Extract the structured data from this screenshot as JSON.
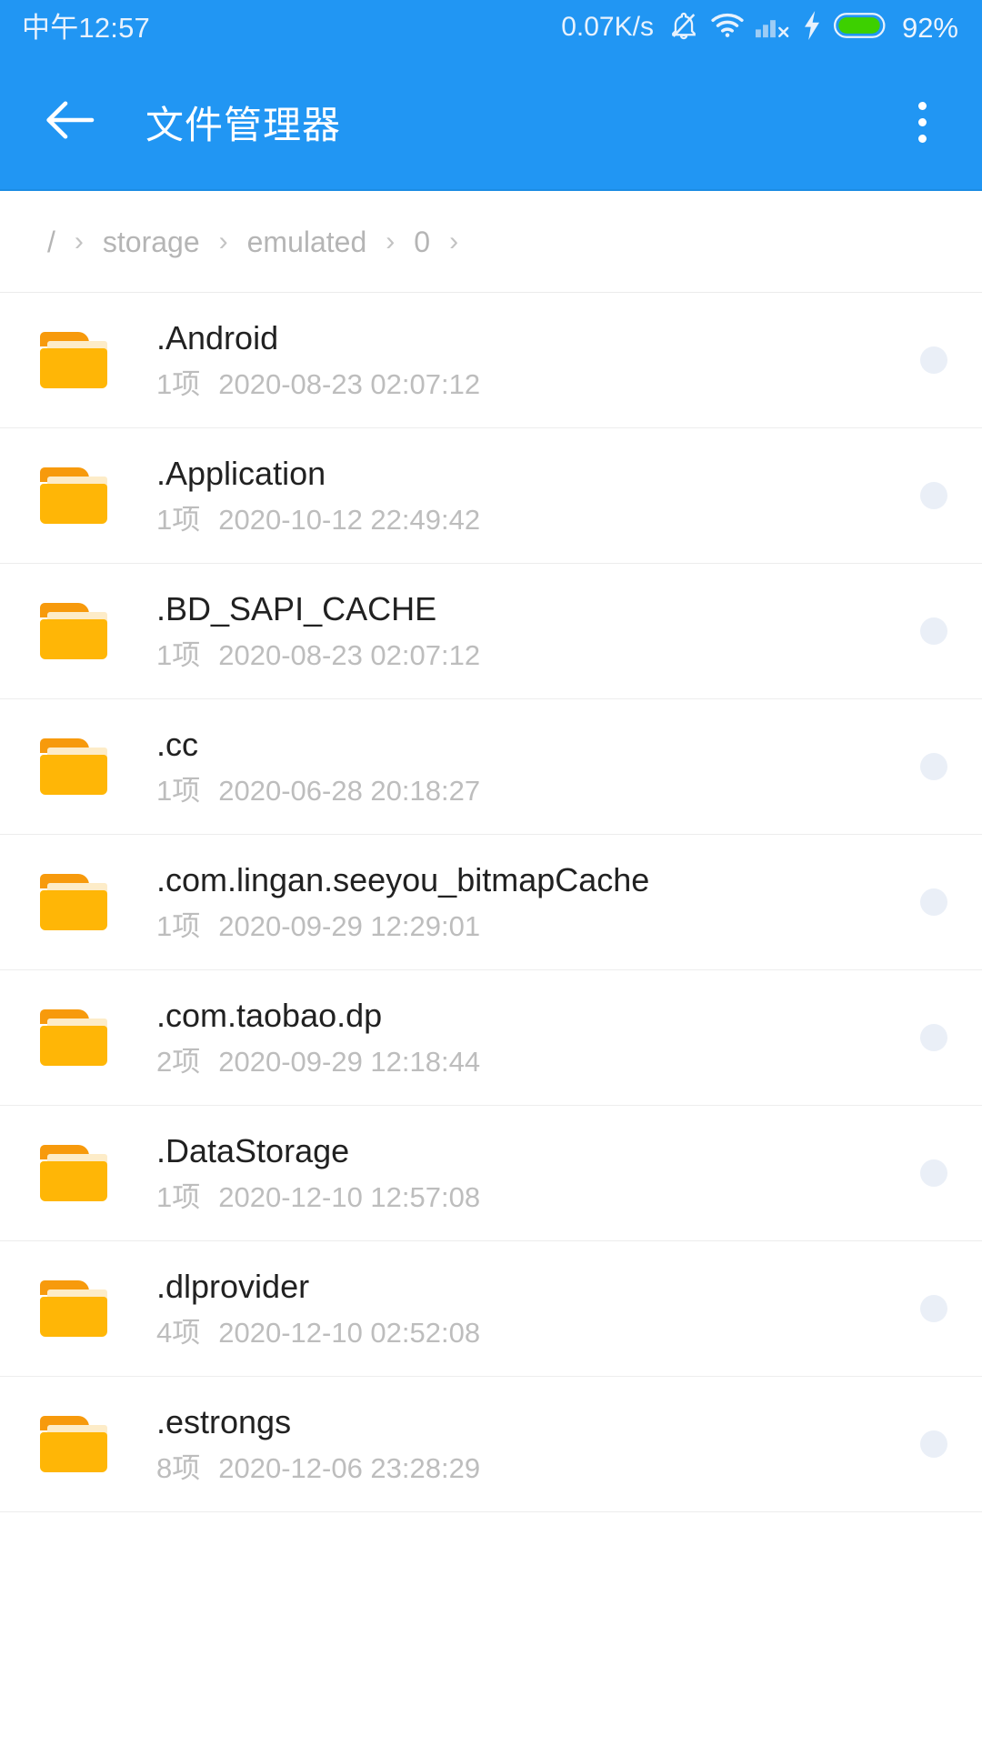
{
  "theme": {
    "accent": "#2196f3",
    "folder_body": "#ffb606",
    "folder_tab": "#f79a0c",
    "folder_sheet": "#fdecc8",
    "indicator": "#eaeff7",
    "title_text": "#ffffff",
    "name_text": "#212121",
    "sub_text": "#bdbdbd",
    "crumb_text": "#b5b5b5"
  },
  "status_bar": {
    "time": "中午12:57",
    "net_speed": "0.07K/s",
    "battery_percent": "92%",
    "icons": [
      "mute-bell-icon",
      "wifi-icon",
      "signal-no-service-icon",
      "charging-bolt-icon",
      "battery-icon"
    ]
  },
  "app_bar": {
    "back_icon": "back-arrow-icon",
    "title": "文件管理器",
    "overflow_icon": "overflow-menu-icon"
  },
  "breadcrumb": {
    "separator": "›",
    "segments": [
      "/",
      "storage",
      "emulated",
      "0"
    ],
    "trailing_separator": "›"
  },
  "file_list": {
    "items": [
      {
        "name": ".Android",
        "count": "1项",
        "modified": "2020-08-23 02:07:12",
        "icon": "folder-icon"
      },
      {
        "name": ".Application",
        "count": "1项",
        "modified": "2020-10-12 22:49:42",
        "icon": "folder-icon"
      },
      {
        "name": ".BD_SAPI_CACHE",
        "count": "1项",
        "modified": "2020-08-23 02:07:12",
        "icon": "folder-icon"
      },
      {
        "name": ".cc",
        "count": "1项",
        "modified": "2020-06-28 20:18:27",
        "icon": "folder-icon"
      },
      {
        "name": ".com.lingan.seeyou_bitmapCache",
        "count": "1项",
        "modified": "2020-09-29 12:29:01",
        "icon": "folder-icon"
      },
      {
        "name": ".com.taobao.dp",
        "count": "2项",
        "modified": "2020-09-29 12:18:44",
        "icon": "folder-icon"
      },
      {
        "name": ".DataStorage",
        "count": "1项",
        "modified": "2020-12-10 12:57:08",
        "icon": "folder-icon"
      },
      {
        "name": ".dlprovider",
        "count": "4项",
        "modified": "2020-12-10 02:52:08",
        "icon": "folder-icon"
      },
      {
        "name": ".estrongs",
        "count": "8项",
        "modified": "2020-12-06 23:28:29",
        "icon": "folder-icon"
      }
    ]
  }
}
